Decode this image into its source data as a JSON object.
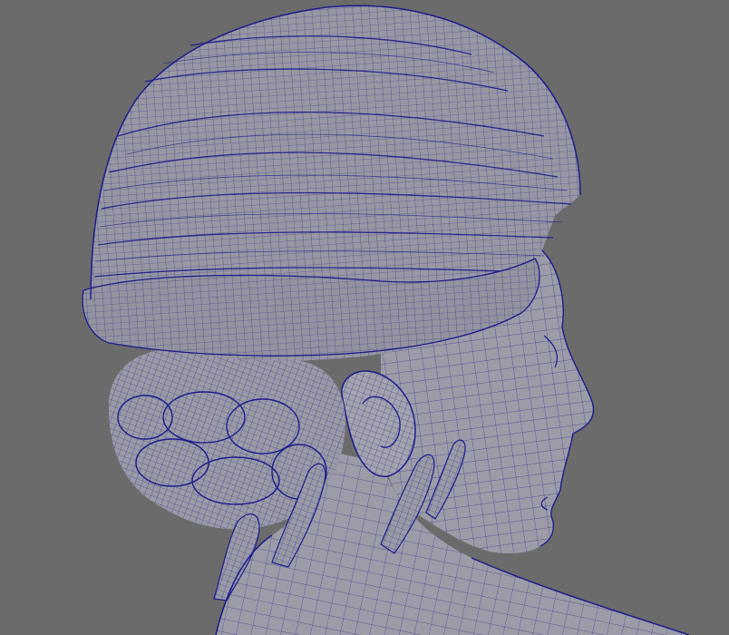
{
  "viewport": {
    "background": "#6b6b6b",
    "mesh_fill": "#9c9ca8",
    "wire_color": "#1c1c8c"
  }
}
